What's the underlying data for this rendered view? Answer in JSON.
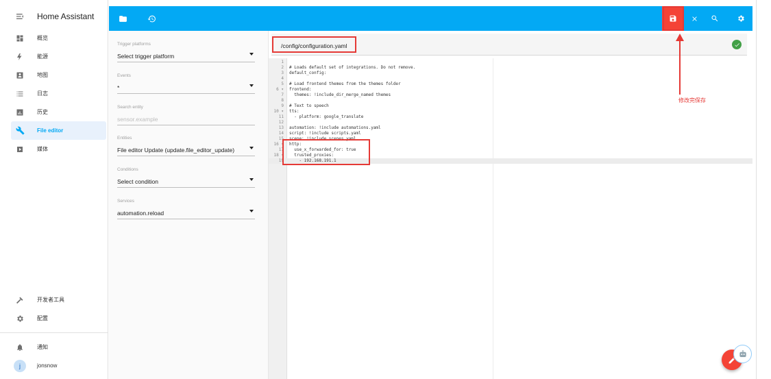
{
  "app": {
    "title": "Home Assistant"
  },
  "sidebar": {
    "items": [
      {
        "label": "概览",
        "icon": "dashboard-icon"
      },
      {
        "label": "能源",
        "icon": "lightning-icon"
      },
      {
        "label": "地图",
        "icon": "map-person-icon"
      },
      {
        "label": "日志",
        "icon": "list-icon"
      },
      {
        "label": "历史",
        "icon": "chart-icon"
      },
      {
        "label": "File editor",
        "icon": "wrench-icon",
        "active": true
      },
      {
        "label": "媒体",
        "icon": "media-icon"
      }
    ],
    "bottom_items": [
      {
        "label": "开发者工具",
        "icon": "hammer-icon"
      },
      {
        "label": "配置",
        "icon": "gear-icon"
      }
    ],
    "notifications_label": "通知",
    "user": {
      "initial": "j",
      "name": "jonsnow"
    }
  },
  "panel": {
    "fields": [
      {
        "label": "Trigger platforms",
        "value": "Select trigger platform",
        "dropdown": true
      },
      {
        "label": "Events",
        "value": "*",
        "dropdown": true
      },
      {
        "label": "Search entity",
        "value": "sensor.example",
        "placeholder": true,
        "dropdown": false
      },
      {
        "label": "Entities",
        "value": "File editor Update (update.file_editor_update)",
        "dropdown": true
      },
      {
        "label": "Conditions",
        "value": "Select condition",
        "dropdown": true
      },
      {
        "label": "Services",
        "value": "automation.reload",
        "dropdown": true
      }
    ]
  },
  "editor": {
    "path": "/config/configuration.yaml",
    "status": "saved",
    "lines": [
      {
        "n": "1",
        "text": ""
      },
      {
        "n": "2",
        "text": "# Loads default set of integrations. Do not remove.",
        "kind": "cmt"
      },
      {
        "n": "3",
        "text": "default_config:",
        "kind": "key"
      },
      {
        "n": "4",
        "text": ""
      },
      {
        "n": "5",
        "text": "# Load frontend themes from the themes folder",
        "kind": "cmt"
      },
      {
        "n": "6 ▾",
        "text": "frontend:",
        "kind": "key"
      },
      {
        "n": "7",
        "text": "  themes: !include_dir_merge_named themes",
        "kind": "key"
      },
      {
        "n": "8",
        "text": ""
      },
      {
        "n": "9",
        "text": "# Text to speech",
        "kind": "cmt"
      },
      {
        "n": "10 ▾",
        "text": "tts:",
        "kind": "key"
      },
      {
        "n": "11",
        "text": "  - platform: google_translate",
        "kind": "str"
      },
      {
        "n": "12",
        "text": ""
      },
      {
        "n": "13",
        "text": "automation: !include automations.yaml",
        "kind": "key"
      },
      {
        "n": "14",
        "text": "script: !include scripts.yaml",
        "kind": "key"
      },
      {
        "n": "15",
        "text": "scene: !include scenes.yaml",
        "kind": "key"
      },
      {
        "n": "16 ▾",
        "text": "http:",
        "kind": "key"
      },
      {
        "n": "17",
        "text": "  use_x_forwarded_for: true",
        "kind": "key"
      },
      {
        "n": "18 ▾",
        "text": "  trusted_proxies:",
        "kind": "key"
      },
      {
        "n": "19",
        "text": "    - 192.168.191.1",
        "kind": "str",
        "current": true
      }
    ]
  },
  "annotation": {
    "note": "修改完保存",
    "color": "#e53935"
  },
  "colors": {
    "toolbar": "#03a9f4",
    "save_button": "#f44336",
    "active_item": "#03a9f4"
  }
}
